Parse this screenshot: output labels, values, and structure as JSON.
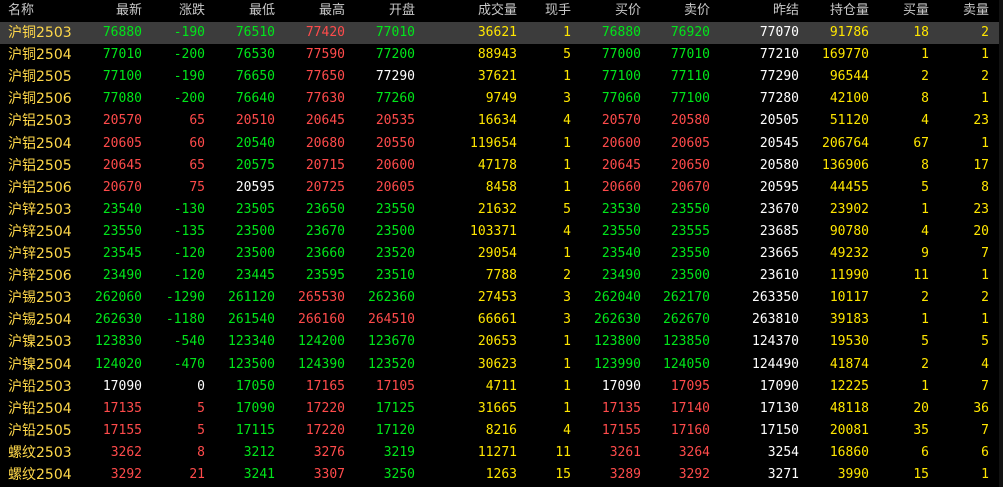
{
  "header": [
    "名称",
    "最新",
    "涨跌",
    "最低",
    "最高",
    "开盘",
    "成交量",
    "现手",
    "买价",
    "卖价",
    "昨结",
    "持仓量",
    "买量",
    "卖量"
  ],
  "rows": [
    {
      "v": [
        "沪铜2503",
        "76880",
        "-190",
        "76510",
        "77420",
        "77010",
        "36621",
        "1",
        "76880",
        "76920",
        "77070",
        "91786",
        "18",
        "2"
      ],
      "c": [
        "n",
        "g",
        "g",
        "g",
        "r",
        "g",
        "y",
        "y",
        "g",
        "g",
        "w",
        "y",
        "y",
        "y"
      ]
    },
    {
      "v": [
        "沪铜2504",
        "77010",
        "-200",
        "76530",
        "77590",
        "77200",
        "88943",
        "5",
        "77000",
        "77010",
        "77210",
        "169770",
        "1",
        "1"
      ],
      "c": [
        "n",
        "g",
        "g",
        "g",
        "r",
        "g",
        "y",
        "y",
        "g",
        "g",
        "w",
        "y",
        "y",
        "y"
      ]
    },
    {
      "v": [
        "沪铜2505",
        "77100",
        "-190",
        "76650",
        "77650",
        "77290",
        "37621",
        "1",
        "77100",
        "77110",
        "77290",
        "96544",
        "2",
        "2"
      ],
      "c": [
        "n",
        "g",
        "g",
        "g",
        "r",
        "w",
        "y",
        "y",
        "g",
        "g",
        "w",
        "y",
        "y",
        "y"
      ]
    },
    {
      "v": [
        "沪铜2506",
        "77080",
        "-200",
        "76640",
        "77630",
        "77260",
        "9749",
        "3",
        "77060",
        "77100",
        "77280",
        "42100",
        "8",
        "1"
      ],
      "c": [
        "n",
        "g",
        "g",
        "g",
        "r",
        "g",
        "y",
        "y",
        "g",
        "g",
        "w",
        "y",
        "y",
        "y"
      ]
    },
    {
      "v": [
        "沪铝2503",
        "20570",
        "65",
        "20510",
        "20645",
        "20535",
        "16634",
        "4",
        "20570",
        "20580",
        "20505",
        "51120",
        "4",
        "23"
      ],
      "c": [
        "n",
        "r",
        "r",
        "r",
        "r",
        "r",
        "y",
        "y",
        "r",
        "r",
        "w",
        "y",
        "y",
        "y"
      ]
    },
    {
      "v": [
        "沪铝2504",
        "20605",
        "60",
        "20540",
        "20680",
        "20550",
        "119654",
        "1",
        "20600",
        "20605",
        "20545",
        "206764",
        "67",
        "1"
      ],
      "c": [
        "n",
        "r",
        "r",
        "g",
        "r",
        "r",
        "y",
        "y",
        "r",
        "r",
        "w",
        "y",
        "y",
        "y"
      ]
    },
    {
      "v": [
        "沪铝2505",
        "20645",
        "65",
        "20575",
        "20715",
        "20600",
        "47178",
        "1",
        "20645",
        "20650",
        "20580",
        "136906",
        "8",
        "17"
      ],
      "c": [
        "n",
        "r",
        "r",
        "g",
        "r",
        "r",
        "y",
        "y",
        "r",
        "r",
        "w",
        "y",
        "y",
        "y"
      ]
    },
    {
      "v": [
        "沪铝2506",
        "20670",
        "75",
        "20595",
        "20725",
        "20605",
        "8458",
        "1",
        "20660",
        "20670",
        "20595",
        "44455",
        "5",
        "8"
      ],
      "c": [
        "n",
        "r",
        "r",
        "w",
        "r",
        "r",
        "y",
        "y",
        "r",
        "r",
        "w",
        "y",
        "y",
        "y"
      ]
    },
    {
      "v": [
        "沪锌2503",
        "23540",
        "-130",
        "23505",
        "23650",
        "23550",
        "21632",
        "5",
        "23530",
        "23550",
        "23670",
        "23902",
        "1",
        "23"
      ],
      "c": [
        "n",
        "g",
        "g",
        "g",
        "g",
        "g",
        "y",
        "y",
        "g",
        "g",
        "w",
        "y",
        "y",
        "y"
      ]
    },
    {
      "v": [
        "沪锌2504",
        "23550",
        "-135",
        "23500",
        "23670",
        "23500",
        "103371",
        "4",
        "23550",
        "23555",
        "23685",
        "90780",
        "4",
        "20"
      ],
      "c": [
        "n",
        "g",
        "g",
        "g",
        "g",
        "g",
        "y",
        "y",
        "g",
        "g",
        "w",
        "y",
        "y",
        "y"
      ]
    },
    {
      "v": [
        "沪锌2505",
        "23545",
        "-120",
        "23500",
        "23660",
        "23520",
        "29054",
        "1",
        "23540",
        "23550",
        "23665",
        "49232",
        "9",
        "7"
      ],
      "c": [
        "n",
        "g",
        "g",
        "g",
        "g",
        "g",
        "y",
        "y",
        "g",
        "g",
        "w",
        "y",
        "y",
        "y"
      ]
    },
    {
      "v": [
        "沪锌2506",
        "23490",
        "-120",
        "23445",
        "23595",
        "23510",
        "7788",
        "2",
        "23490",
        "23500",
        "23610",
        "11990",
        "11",
        "1"
      ],
      "c": [
        "n",
        "g",
        "g",
        "g",
        "g",
        "g",
        "y",
        "y",
        "g",
        "g",
        "w",
        "y",
        "y",
        "y"
      ]
    },
    {
      "v": [
        "沪锡2503",
        "262060",
        "-1290",
        "261120",
        "265530",
        "262360",
        "27453",
        "3",
        "262040",
        "262170",
        "263350",
        "10117",
        "2",
        "2"
      ],
      "c": [
        "n",
        "g",
        "g",
        "g",
        "r",
        "g",
        "y",
        "y",
        "g",
        "g",
        "w",
        "y",
        "y",
        "y"
      ]
    },
    {
      "v": [
        "沪锡2504",
        "262630",
        "-1180",
        "261540",
        "266160",
        "264510",
        "66661",
        "3",
        "262630",
        "262670",
        "263810",
        "39183",
        "1",
        "1"
      ],
      "c": [
        "n",
        "g",
        "g",
        "g",
        "r",
        "r",
        "y",
        "y",
        "g",
        "g",
        "w",
        "y",
        "y",
        "y"
      ]
    },
    {
      "v": [
        "沪镍2503",
        "123830",
        "-540",
        "123340",
        "124200",
        "123670",
        "20653",
        "1",
        "123800",
        "123850",
        "124370",
        "19530",
        "5",
        "5"
      ],
      "c": [
        "n",
        "g",
        "g",
        "g",
        "g",
        "g",
        "y",
        "y",
        "g",
        "g",
        "w",
        "y",
        "y",
        "y"
      ]
    },
    {
      "v": [
        "沪镍2504",
        "124020",
        "-470",
        "123500",
        "124390",
        "123520",
        "30623",
        "1",
        "123990",
        "124050",
        "124490",
        "41874",
        "2",
        "4"
      ],
      "c": [
        "n",
        "g",
        "g",
        "g",
        "g",
        "g",
        "y",
        "y",
        "g",
        "g",
        "w",
        "y",
        "y",
        "y"
      ]
    },
    {
      "v": [
        "沪铅2503",
        "17090",
        "0",
        "17050",
        "17165",
        "17105",
        "4711",
        "1",
        "17090",
        "17095",
        "17090",
        "12225",
        "1",
        "7"
      ],
      "c": [
        "n",
        "w",
        "w",
        "g",
        "r",
        "r",
        "y",
        "y",
        "w",
        "r",
        "w",
        "y",
        "y",
        "y"
      ]
    },
    {
      "v": [
        "沪铅2504",
        "17135",
        "5",
        "17090",
        "17220",
        "17125",
        "31665",
        "1",
        "17135",
        "17140",
        "17130",
        "48118",
        "20",
        "36"
      ],
      "c": [
        "n",
        "r",
        "r",
        "g",
        "r",
        "g",
        "y",
        "y",
        "r",
        "r",
        "w",
        "y",
        "y",
        "y"
      ]
    },
    {
      "v": [
        "沪铅2505",
        "17155",
        "5",
        "17115",
        "17220",
        "17120",
        "8216",
        "4",
        "17155",
        "17160",
        "17150",
        "20081",
        "35",
        "7"
      ],
      "c": [
        "n",
        "r",
        "r",
        "g",
        "r",
        "g",
        "y",
        "y",
        "r",
        "r",
        "w",
        "y",
        "y",
        "y"
      ]
    },
    {
      "v": [
        "螺纹2503",
        "3262",
        "8",
        "3212",
        "3276",
        "3219",
        "11271",
        "11",
        "3261",
        "3264",
        "3254",
        "16860",
        "6",
        "6"
      ],
      "c": [
        "n",
        "r",
        "r",
        "g",
        "r",
        "g",
        "y",
        "y",
        "r",
        "r",
        "w",
        "y",
        "y",
        "y"
      ]
    },
    {
      "v": [
        "螺纹2504",
        "3292",
        "21",
        "3241",
        "3307",
        "3250",
        "1263",
        "15",
        "3289",
        "3292",
        "3271",
        "3990",
        "15",
        "1"
      ],
      "c": [
        "n",
        "r",
        "r",
        "g",
        "r",
        "g",
        "y",
        "y",
        "r",
        "r",
        "w",
        "y",
        "y",
        "y"
      ]
    }
  ],
  "colors": {
    "r": "#ff4b4b",
    "g": "#00e61a",
    "w": "#ffffff",
    "y": "#ffe600",
    "n": "#ffd84a"
  }
}
